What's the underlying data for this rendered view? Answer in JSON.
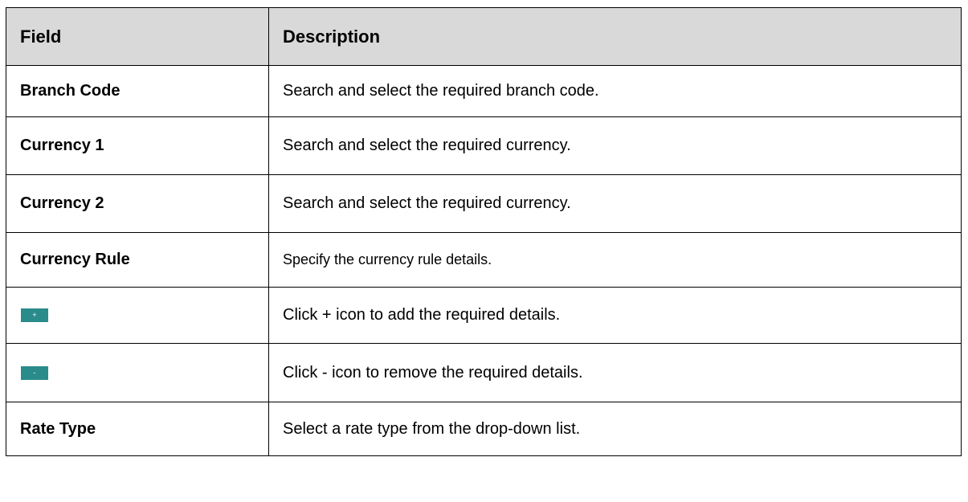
{
  "header": {
    "field": "Field",
    "description": "Description"
  },
  "rows": [
    {
      "field": "Branch Code",
      "description": "Search and select the required branch code."
    },
    {
      "field": "Currency 1",
      "description": "Search and select the required currency."
    },
    {
      "field": "Currency 2",
      "description": "Search and select the required currency."
    },
    {
      "field": "Currency Rule",
      "description": "Specify the currency rule details."
    },
    {
      "field_icon": "plus-icon",
      "field_icon_glyph": "+",
      "description": "Click + icon to add the required details."
    },
    {
      "field_icon": "minus-icon",
      "field_icon_glyph": "-",
      "description": "Click - icon to remove the required details."
    },
    {
      "field": "Rate Type",
      "description": "Select a rate type from the drop-down list."
    }
  ],
  "colors": {
    "header_background": "#d9d9d9",
    "icon_button": "#2a8b8b",
    "border": "#000000"
  }
}
